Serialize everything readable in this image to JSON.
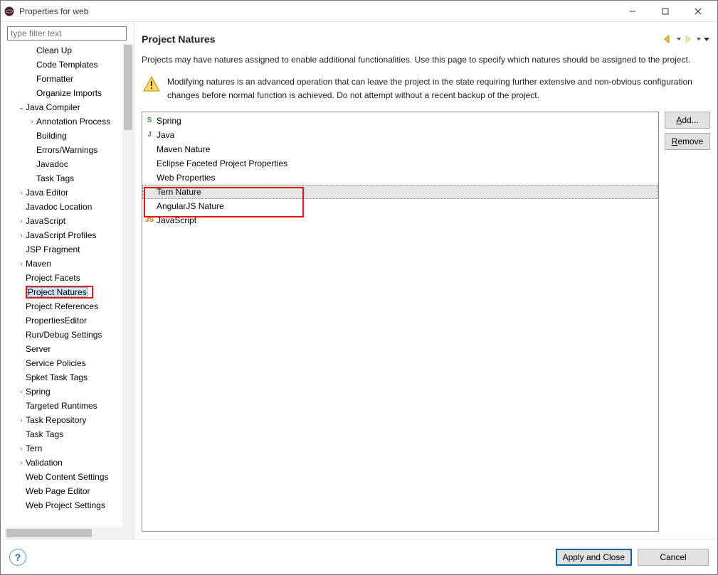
{
  "window": {
    "title": "Properties for web"
  },
  "filter": {
    "placeholder": "type filter text"
  },
  "tree": {
    "items": [
      {
        "label": "Clean Up",
        "indent": 2,
        "twisty": ""
      },
      {
        "label": "Code Templates",
        "indent": 2,
        "twisty": ""
      },
      {
        "label": "Formatter",
        "indent": 2,
        "twisty": ""
      },
      {
        "label": "Organize Imports",
        "indent": 2,
        "twisty": ""
      },
      {
        "label": "Java Compiler",
        "indent": 1,
        "twisty": "v"
      },
      {
        "label": "Annotation Process",
        "indent": 2,
        "twisty": ">"
      },
      {
        "label": "Building",
        "indent": 2,
        "twisty": ""
      },
      {
        "label": "Errors/Warnings",
        "indent": 2,
        "twisty": ""
      },
      {
        "label": "Javadoc",
        "indent": 2,
        "twisty": ""
      },
      {
        "label": "Task Tags",
        "indent": 2,
        "twisty": ""
      },
      {
        "label": "Java Editor",
        "indent": 1,
        "twisty": ">"
      },
      {
        "label": "Javadoc Location",
        "indent": 1,
        "twisty": ""
      },
      {
        "label": "JavaScript",
        "indent": 1,
        "twisty": ">"
      },
      {
        "label": "JavaScript Profiles",
        "indent": 1,
        "twisty": ">"
      },
      {
        "label": "JSP Fragment",
        "indent": 1,
        "twisty": ""
      },
      {
        "label": "Maven",
        "indent": 1,
        "twisty": ">"
      },
      {
        "label": "Project Facets",
        "indent": 1,
        "twisty": ""
      },
      {
        "label": "Project Natures",
        "indent": 1,
        "twisty": "",
        "selected": true,
        "redbox": true
      },
      {
        "label": "Project References",
        "indent": 1,
        "twisty": ""
      },
      {
        "label": "PropertiesEditor",
        "indent": 1,
        "twisty": ""
      },
      {
        "label": "Run/Debug Settings",
        "indent": 1,
        "twisty": ""
      },
      {
        "label": "Server",
        "indent": 1,
        "twisty": ""
      },
      {
        "label": "Service Policies",
        "indent": 1,
        "twisty": ""
      },
      {
        "label": "Spket Task Tags",
        "indent": 1,
        "twisty": ""
      },
      {
        "label": "Spring",
        "indent": 1,
        "twisty": ">"
      },
      {
        "label": "Targeted Runtimes",
        "indent": 1,
        "twisty": ""
      },
      {
        "label": "Task Repository",
        "indent": 1,
        "twisty": ">"
      },
      {
        "label": "Task Tags",
        "indent": 1,
        "twisty": ""
      },
      {
        "label": "Tern",
        "indent": 1,
        "twisty": ">"
      },
      {
        "label": "Validation",
        "indent": 1,
        "twisty": ">"
      },
      {
        "label": "Web Content Settings",
        "indent": 1,
        "twisty": ""
      },
      {
        "label": "Web Page Editor",
        "indent": 1,
        "twisty": ""
      },
      {
        "label": "Web Project Settings",
        "indent": 1,
        "twisty": ""
      }
    ]
  },
  "page": {
    "title": "Project Natures",
    "description": "Projects may have natures assigned to enable additional functionalities. Use this page to specify which natures should be assigned to the project.",
    "warning": "Modifying natures is an advanced operation that can leave the project in the state requiring further extensive and non-obvious configuration changes before normal function is achieved. Do not attempt without a recent backup of the project."
  },
  "natures": {
    "items": [
      {
        "label": "Spring",
        "icon": "S",
        "iconcolor": "#3a8f3a"
      },
      {
        "label": "Java",
        "icon": "J",
        "iconcolor": "#3b6db5"
      },
      {
        "label": "Maven Nature",
        "icon": "",
        "iconcolor": ""
      },
      {
        "label": "Eclipse Faceted Project Properties",
        "icon": "",
        "iconcolor": ""
      },
      {
        "label": "Web Properties",
        "icon": "",
        "iconcolor": ""
      },
      {
        "label": "Tern Nature",
        "icon": "",
        "iconcolor": "",
        "selected": true
      },
      {
        "label": "AngularJS Nature",
        "icon": "",
        "iconcolor": ""
      },
      {
        "label": "JavaScript",
        "icon": "JS",
        "iconcolor": "#b58900"
      }
    ]
  },
  "buttons": {
    "add": "Add...",
    "remove": "Remove",
    "apply": "Apply and Close",
    "cancel": "Cancel"
  }
}
